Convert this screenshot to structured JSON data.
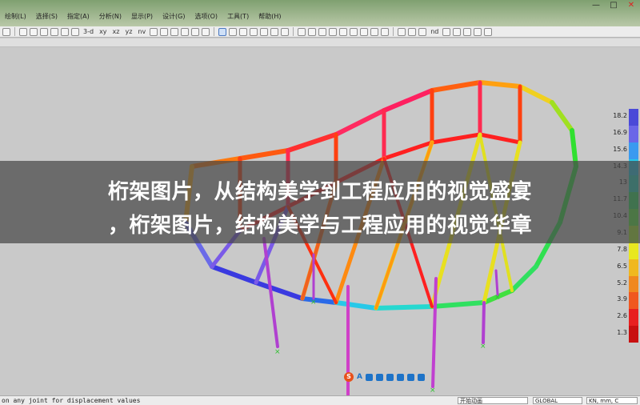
{
  "menu": [
    "绘制(L)",
    "选择(S)",
    "指定(A)",
    "分析(N)",
    "显示(P)",
    "设计(G)",
    "选项(O)",
    "工具(T)",
    "帮助(H)"
  ],
  "window_buttons": [
    "—",
    "□",
    "✕"
  ],
  "toolbar_text": [
    "3-d",
    "xy",
    "xz",
    "yz",
    "nv"
  ],
  "toolbar_text2": [
    "nd"
  ],
  "legend": {
    "labels": [
      "18.2",
      "16.9",
      "15.6",
      "14.3",
      "13",
      "11.7",
      "10.4",
      "9.1",
      "7.8",
      "6.5",
      "5.2",
      "3.9",
      "2.6",
      "1.3"
    ],
    "colors": [
      "#4a4ad8",
      "#6a66e8",
      "#3a9af0",
      "#28c8e8",
      "#26d8c0",
      "#30e060",
      "#5af040",
      "#a8f030",
      "#e8e820",
      "#f0b820",
      "#f08820",
      "#f05820",
      "#e82020",
      "#c81010"
    ]
  },
  "banner": {
    "line1": "桁架图片，从结构美学到工程应用的视觉盛宴",
    "line2": "，桁架图片，结构美学与工程应用的视觉华章"
  },
  "status": {
    "message": "on any joint for displacement values",
    "fields": [
      "开始动画",
      "GLOBAL",
      "KN, mm, C"
    ]
  },
  "ime_logo": "S",
  "ime_text": "A"
}
